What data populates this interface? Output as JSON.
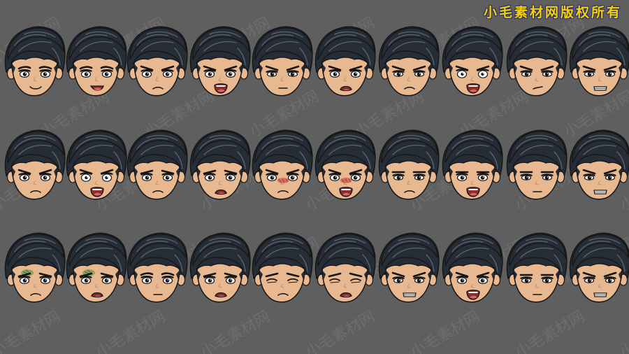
{
  "title": "小毛素材网版权所有",
  "watermark": "小毛素材网",
  "colors": {
    "background": "#5f5f5f",
    "title_text": "#f3d400",
    "hair": "#262d36",
    "hair_highlight": "#5b6472",
    "skin": "#e8b891",
    "skin_shadow": "#c89672",
    "outline": "#141414",
    "mouth_inner": "#8a2f2a",
    "tongue": "#d9646a",
    "blush_red": "#d2574f",
    "sick_green": "#6b9a53",
    "watermark": "rgba(255,255,255,0.09)"
  },
  "faces": [
    [
      "smile",
      "open-smile",
      "frown",
      "angry-shout",
      "angry",
      "angry-open",
      "stern",
      "rage-shout",
      "smirk",
      "grimace"
    ],
    [
      "sad-down",
      "shocked",
      "worried",
      "distressed",
      "blush-angry",
      "blush-shout",
      "glare",
      "shout-left",
      "serious",
      "sneer"
    ],
    [
      "sick",
      "sick-shout",
      "neutral",
      "worried-open",
      "squint",
      "pain",
      "teeth-grit",
      "yell",
      "annoyed",
      "snarl"
    ]
  ]
}
